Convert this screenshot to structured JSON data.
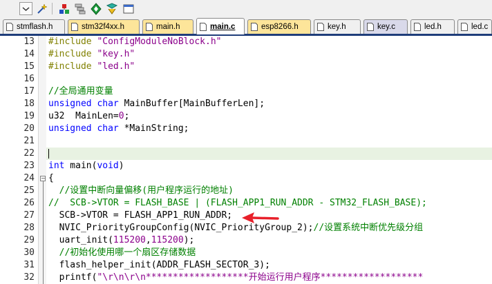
{
  "toolbar": {
    "icons": [
      "dropdown-arrow-icon",
      "wand-icon",
      "pin-icon",
      "stack-icon",
      "diamond-icon",
      "filter-icon"
    ]
  },
  "tabs": [
    {
      "label": "stmflash.h",
      "color": "#ffffff",
      "active": false
    },
    {
      "label": "stm32f4xx.h",
      "color": "#fde59a",
      "active": false
    },
    {
      "label": "main.h",
      "color": "#fde59a",
      "active": false
    },
    {
      "label": "main.c",
      "color": "#ffffff",
      "active": true
    },
    {
      "label": "esp8266.h",
      "color": "#fde59a",
      "active": false
    },
    {
      "label": "key.h",
      "color": "#ffffff",
      "active": false
    },
    {
      "label": "key.c",
      "color": "#d9d9ea",
      "active": false
    },
    {
      "label": "led.h",
      "color": "#ffffff",
      "active": false
    },
    {
      "label": "led.c",
      "color": "#ffffff",
      "active": false
    }
  ],
  "editor": {
    "current_line": 22,
    "lines": [
      {
        "num": "13",
        "segs": [
          {
            "t": "#include ",
            "c": "pp"
          },
          {
            "t": "\"ConfigModuleNoBlock.h\"",
            "c": "st"
          }
        ]
      },
      {
        "num": "14",
        "segs": [
          {
            "t": "#include ",
            "c": "pp"
          },
          {
            "t": "\"key.h\"",
            "c": "st"
          }
        ]
      },
      {
        "num": "15",
        "segs": [
          {
            "t": "#include ",
            "c": "pp"
          },
          {
            "t": "\"led.h\"",
            "c": "st"
          }
        ]
      },
      {
        "num": "16",
        "segs": []
      },
      {
        "num": "17",
        "segs": [
          {
            "t": "//全局通用变量",
            "c": "cm"
          }
        ]
      },
      {
        "num": "18",
        "segs": [
          {
            "t": "unsigned char",
            "c": "kw"
          },
          {
            "t": " MainBuffer[MainBufferLen];",
            "c": ""
          }
        ]
      },
      {
        "num": "19",
        "segs": [
          {
            "t": "u32  MainLen=",
            "c": ""
          },
          {
            "t": "0",
            "c": "nm"
          },
          {
            "t": ";",
            "c": ""
          }
        ]
      },
      {
        "num": "20",
        "segs": [
          {
            "t": "unsigned char",
            "c": "kw"
          },
          {
            "t": " *MainString;",
            "c": ""
          }
        ]
      },
      {
        "num": "21",
        "segs": []
      },
      {
        "num": "22",
        "segs": []
      },
      {
        "num": "23",
        "segs": [
          {
            "t": "int",
            "c": "kw"
          },
          {
            "t": " main(",
            "c": ""
          },
          {
            "t": "void",
            "c": "kw"
          },
          {
            "t": ")",
            "c": ""
          }
        ]
      },
      {
        "num": "24",
        "segs": [
          {
            "t": "{",
            "c": ""
          }
        ]
      },
      {
        "num": "25",
        "segs": [
          {
            "t": "  //设置中断向量偏移(用户程序运行的地址)",
            "c": "cm"
          }
        ]
      },
      {
        "num": "26",
        "segs": [
          {
            "t": "//  SCB->VTOR = FLASH_BASE | (FLASH_APP1_RUN_ADDR - STM32_FLASH_BASE);",
            "c": "cm"
          }
        ]
      },
      {
        "num": "27",
        "segs": [
          {
            "t": "  SCB->VTOR = FLASH_APP1_RUN_ADDR;",
            "c": ""
          }
        ]
      },
      {
        "num": "28",
        "segs": [
          {
            "t": "  NVIC_PriorityGroupConfig(NVIC_PriorityGroup_2);",
            "c": ""
          },
          {
            "t": "//设置系统中断优先级分组",
            "c": "cm"
          }
        ]
      },
      {
        "num": "29",
        "segs": [
          {
            "t": "  uart_init(",
            "c": ""
          },
          {
            "t": "115200",
            "c": "nm"
          },
          {
            "t": ",",
            "c": ""
          },
          {
            "t": "115200",
            "c": "nm"
          },
          {
            "t": ");",
            "c": ""
          }
        ]
      },
      {
        "num": "30",
        "segs": [
          {
            "t": "  //初始化使用哪一个扇区存储数据",
            "c": "cm"
          }
        ]
      },
      {
        "num": "31",
        "segs": [
          {
            "t": "  flash_helper_init(ADDR_FLASH_SECTOR_3);",
            "c": ""
          }
        ]
      },
      {
        "num": "32",
        "segs": [
          {
            "t": "  printf(",
            "c": ""
          },
          {
            "t": "\"\\r\\n\\r\\n*******************开始运行用户程序*******************",
            "c": "st"
          }
        ]
      }
    ]
  }
}
